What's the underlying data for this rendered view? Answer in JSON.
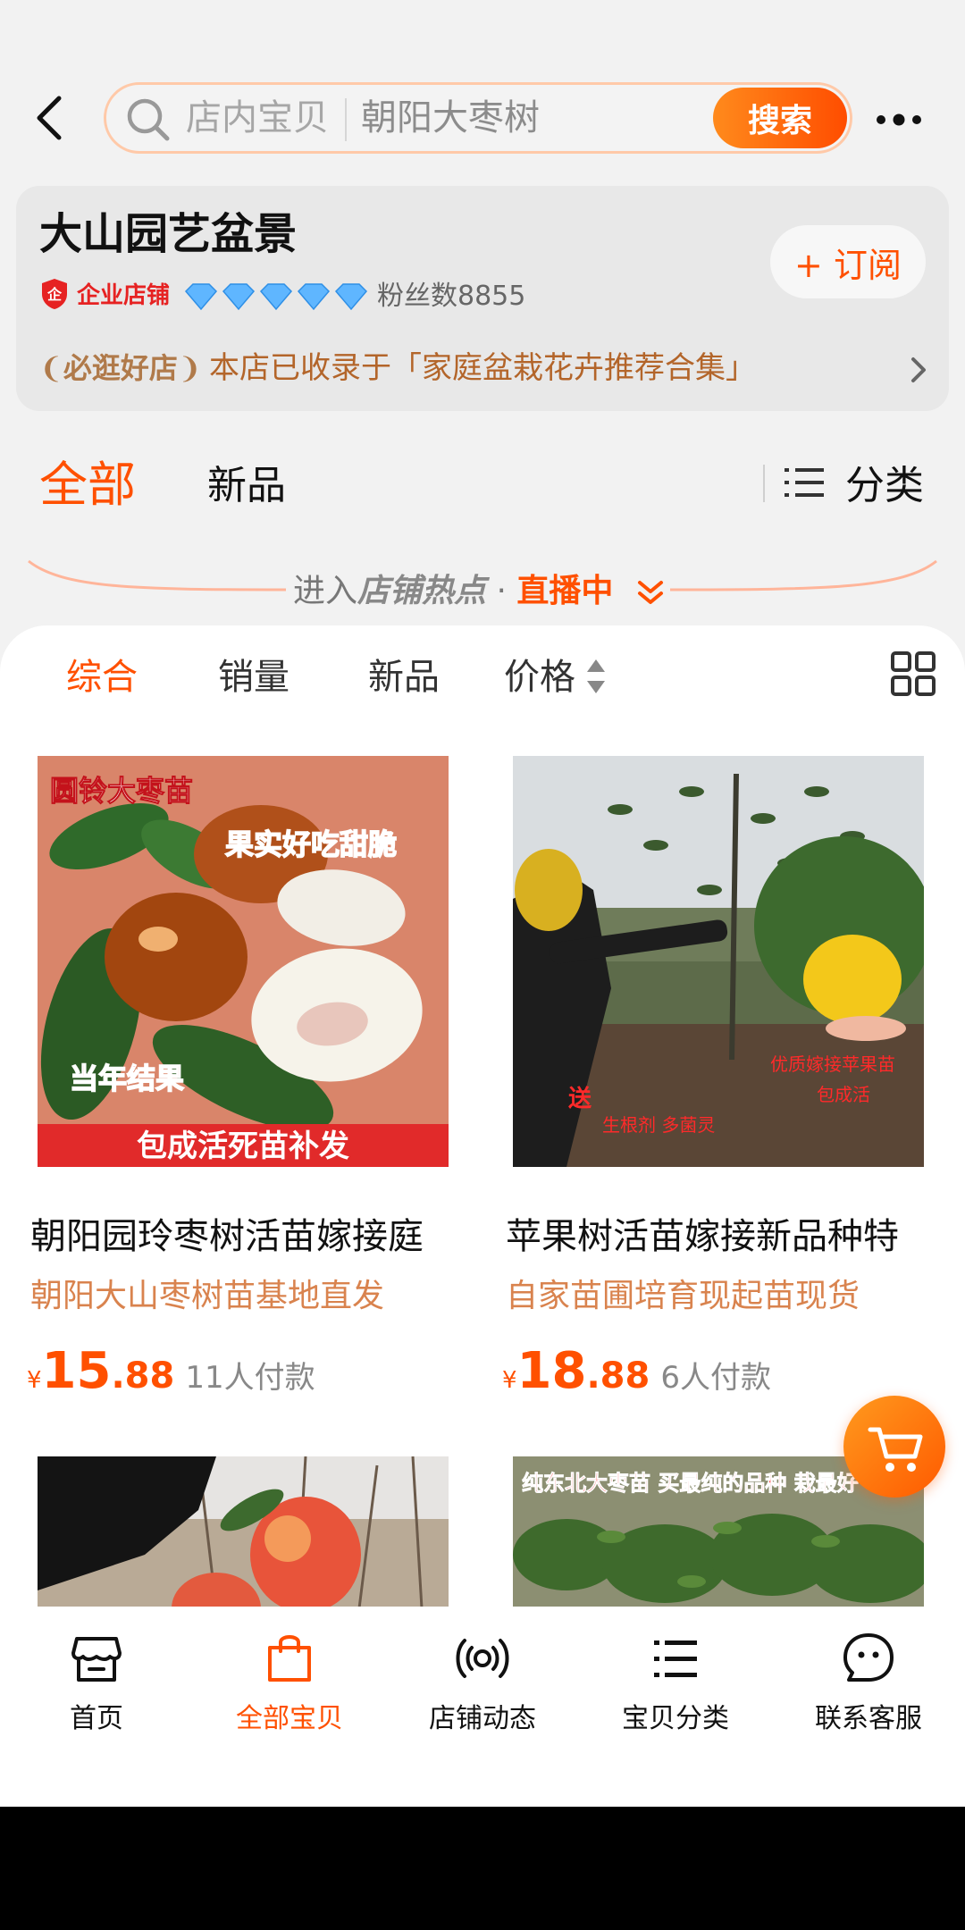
{
  "header": {
    "search_scope": "店内宝贝",
    "search_placeholder": "朝阳大枣树",
    "search_button": "搜索"
  },
  "shop": {
    "name": "大山园艺盆景",
    "badge": "企业店铺",
    "diamond_rating": 5,
    "fans": "粉丝数8855",
    "subscribe_label": "订阅",
    "must_visit_badge": "必逛好店",
    "promo_text": "本店已收录于「家庭盆栽花卉推荐合集」"
  },
  "tabs": {
    "all": "全部",
    "new": "新品",
    "category": "分类"
  },
  "live_banner": {
    "prefix": "进入",
    "strong": "店铺热点",
    "dot": " · ",
    "live": "直播中"
  },
  "sort": {
    "comprehensive": "综合",
    "sales": "销量",
    "new": "新品",
    "price": "价格"
  },
  "products": [
    {
      "title": "朝阳园玲枣树活苗嫁接庭",
      "subtitle": "朝阳大山枣树苗基地直发",
      "currency": "¥",
      "price_int": "15",
      "price_dec": ".88",
      "paid": "11人付款",
      "img_text_1": "圆铃大枣苗",
      "img_text_2": "果实好吃甜脆",
      "img_text_3": "当年结果",
      "img_text_4": "包成活死苗补发"
    },
    {
      "title": "苹果树活苗嫁接新品种特",
      "subtitle": "自家苗圃培育现起苗现货",
      "currency": "¥",
      "price_int": "18",
      "price_dec": ".88",
      "paid": "6人付款",
      "img_text_1": "优质嫁接苹果苗",
      "img_text_2": "包成活",
      "img_text_3": "送",
      "img_text_4": "生根剂  多菌灵"
    },
    {
      "img_text_1": "纯东北大枣苗 买最纯的品种 栽最好"
    }
  ],
  "bottom_nav": {
    "home": "首页",
    "all": "全部宝贝",
    "feed": "店铺动态",
    "category": "宝贝分类",
    "service": "联系客服"
  },
  "colors": {
    "accent": "#ff5000",
    "promo": "#b3652a",
    "subtitle": "#d9834e"
  }
}
